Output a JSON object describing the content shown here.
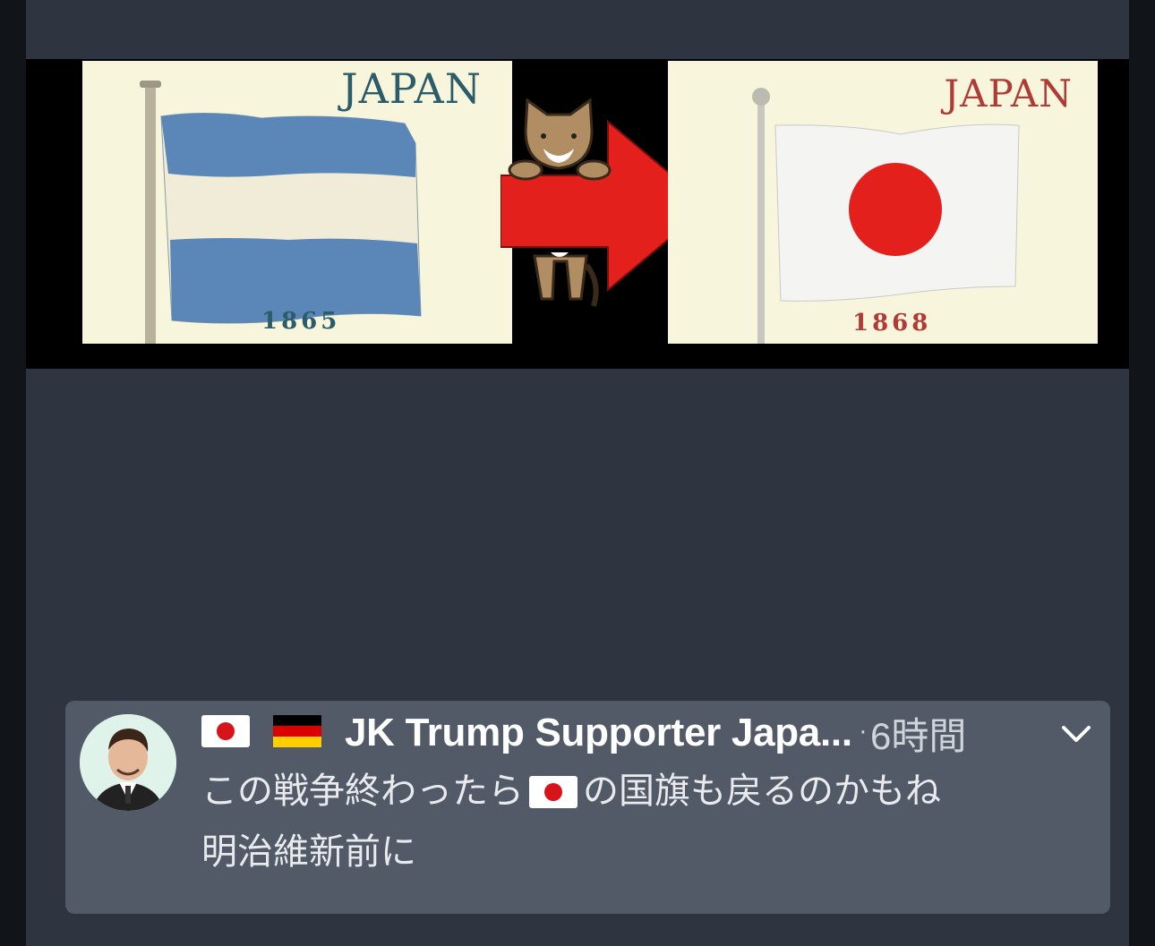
{
  "image": {
    "left_card": {
      "label": "JAPAN",
      "year": "1865"
    },
    "right_card": {
      "label": "JAPAN",
      "year": "1868"
    },
    "arrow_icon": "red-right-arrow-icon",
    "mascot_icon": "cat-mascot-icon"
  },
  "notification": {
    "avatar_icon": "user-avatar-icon",
    "sender_flags": [
      "jp-flag-icon",
      "de-flag-icon"
    ],
    "sender": "JK Trump Supporter Japa...",
    "separator": "·",
    "time": "6時間",
    "expand_icon": "chevron-down-icon",
    "message_line1_before": "この戦争終わったら",
    "message_line1_flag": "jp-flag-icon",
    "message_line1_after": "の国旗も戻るのかもね",
    "message_line2": "明治維新前に"
  },
  "colors": {
    "background": "#2e3540",
    "card": "#515a66",
    "japan_red": "#e3201b",
    "argentine_blue": "#5b86b8"
  }
}
